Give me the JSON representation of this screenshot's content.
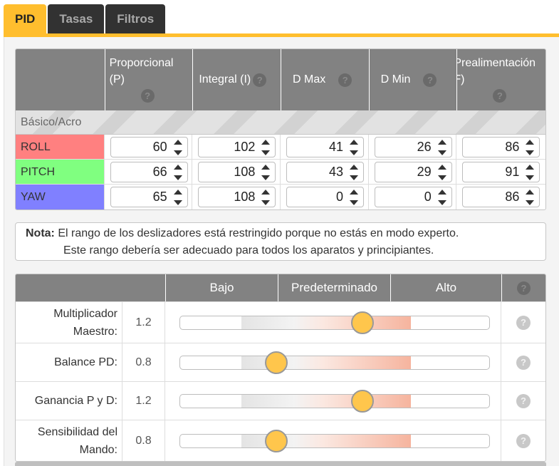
{
  "tabs": [
    {
      "label": "PID",
      "active": true
    },
    {
      "label": "Tasas",
      "active": false
    },
    {
      "label": "Filtros",
      "active": false
    }
  ],
  "pid_table": {
    "headers": {
      "p_line1": "Proporcional",
      "p_line2": "(P)",
      "i": "Integral (I)",
      "dmax": "D Max",
      "dmin": "D Min",
      "f_line1": "Prealimentación",
      "f_line2": "F)"
    },
    "section": "Básico/Acro",
    "rows": [
      {
        "axis": "ROLL",
        "color": "#ff8080",
        "values": [
          "60",
          "102",
          "41",
          "26",
          "86"
        ]
      },
      {
        "axis": "PITCH",
        "color": "#80ff80",
        "values": [
          "66",
          "108",
          "43",
          "29",
          "91"
        ]
      },
      {
        "axis": "YAW",
        "color": "#8080ff",
        "values": [
          "65",
          "108",
          "0",
          "0",
          "86"
        ]
      }
    ]
  },
  "note": {
    "bold": "Nota:",
    "line1": " El rango de los deslizadores está restringido porque no estás en modo experto.",
    "line2": "Este rango debería ser adecuado para todos los aparatos y principiantes."
  },
  "sliders": {
    "headers": {
      "low": "Bajo",
      "default": "Predeterminado",
      "high": "Alto"
    },
    "rows": [
      {
        "label_line1": "Multiplicador",
        "label_line2": "Maestro:",
        "value": "1.2",
        "fraction": 0.59
      },
      {
        "label_line1": "",
        "label_line2": "Balance PD:",
        "value": "0.8",
        "fraction": 0.31
      },
      {
        "label_line1": "",
        "label_line2": "Ganancia P y D:",
        "value": "1.2",
        "fraction": 0.59
      },
      {
        "label_line1": "Sensibilidad del",
        "label_line2": "Mando:",
        "value": "0.8",
        "fraction": 0.31
      }
    ]
  },
  "colors": {
    "accent": "#ffbe2e",
    "header_bg": "#828282",
    "thumb": "#ffc64c"
  },
  "icons": {
    "help": "question-circle-icon",
    "spinner": "up-down-spinner-icon"
  }
}
